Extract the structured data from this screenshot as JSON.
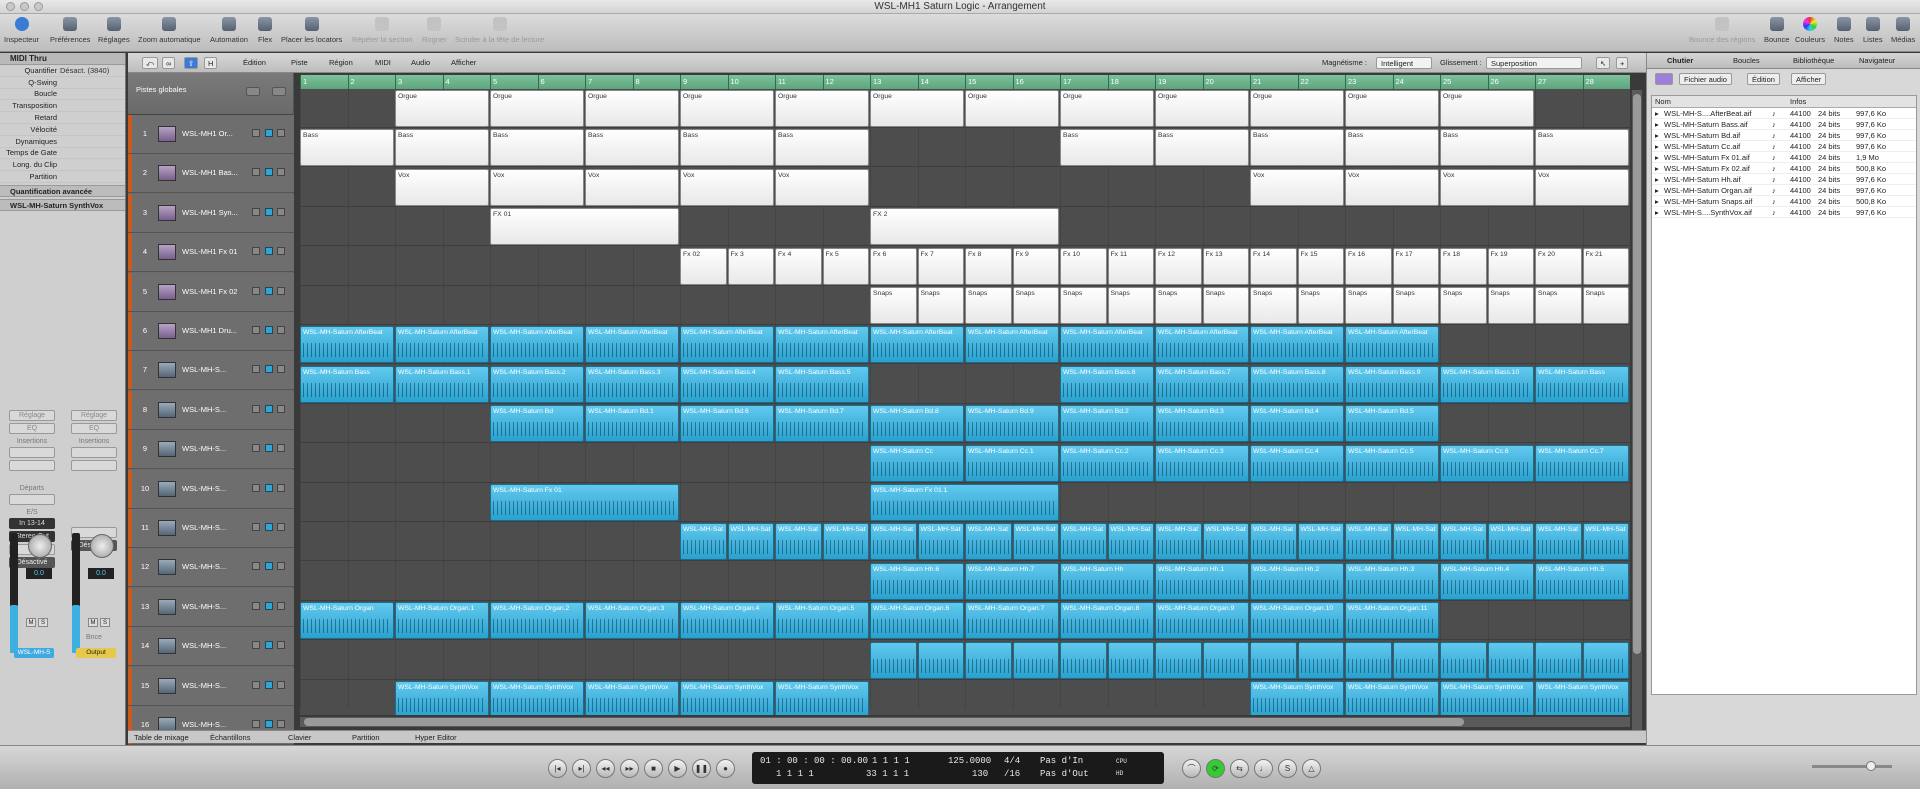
{
  "window": {
    "title": "WSL-MH1 Saturn Logic - Arrangement"
  },
  "toolbar": {
    "left": [
      "Inspecteur",
      "Préférences",
      "Réglages",
      "Zoom automatique",
      "Automation",
      "Flex",
      "Placer les locators",
      "Répéter la section",
      "Rogner",
      "Scinder à la tête de lecture"
    ],
    "right": [
      "Bounce des régions",
      "Bounce",
      "Couleurs",
      "Notes",
      "Listes",
      "Médias"
    ]
  },
  "inspector": {
    "header": "MIDI Thru",
    "params": [
      {
        "label": "Quantifier",
        "value": "Désact. (3840)"
      },
      {
        "label": "Q-Swing",
        "value": ""
      },
      {
        "label": "Boucle",
        "value": ""
      },
      {
        "label": "Transposition",
        "value": ""
      },
      {
        "label": "Retard",
        "value": ""
      },
      {
        "label": "Vélocité",
        "value": ""
      },
      {
        "label": "Dynamiques",
        "value": ""
      },
      {
        "label": "Temps de Gate",
        "value": ""
      },
      {
        "label": "Long. du Clip",
        "value": ""
      },
      {
        "label": "Partition",
        "value": ""
      }
    ],
    "advanced": "Quantification avancée",
    "track_section": "WSL-MH-Saturn SynthVox",
    "strip_left": {
      "setting": "Réglage",
      "eq": "EQ",
      "inserts": "Insertions",
      "sends": "Départs",
      "io": "E/S",
      "input": "In 13-14",
      "output": "Stereo Out",
      "state": "Désactivé",
      "volume": "0.0",
      "name": "WSL-MH-S"
    },
    "strip_right": {
      "setting": "Réglage",
      "eq": "EQ",
      "inserts": "Insertions",
      "state": "Désactivé",
      "volume": "0.0",
      "bounce": "Bnce",
      "name": "Output"
    }
  },
  "menubar": {
    "edit": "Édition",
    "track": "Piste",
    "region": "Région",
    "midi": "MIDI",
    "audio": "Audio",
    "view": "Afficher",
    "magnet_label": "Magnétisme :",
    "magnet_value": "Intelligent",
    "slip_label": "Glissement :",
    "slip_value": "Superposition"
  },
  "global_tracks": "Pistes globales",
  "ruler": [
    "1",
    "2",
    "3",
    "4",
    "5",
    "6",
    "7",
    "8",
    "9",
    "10",
    "11",
    "12",
    "13",
    "14",
    "15",
    "16",
    "17",
    "18",
    "19",
    "20",
    "21",
    "22",
    "23",
    "24",
    "25",
    "26",
    "27",
    "28"
  ],
  "tracks": [
    {
      "num": "1",
      "name": "WSL-MH1 Or...",
      "type": "midi"
    },
    {
      "num": "2",
      "name": "WSL-MH1 Bas...",
      "type": "midi"
    },
    {
      "num": "3",
      "name": "WSL-MH1 Syn...",
      "type": "midi"
    },
    {
      "num": "4",
      "name": "WSL-MH1 Fx 01",
      "type": "midi"
    },
    {
      "num": "5",
      "name": "WSL-MH1 Fx 02",
      "type": "midi"
    },
    {
      "num": "6",
      "name": "WSL-MH1 Dru...",
      "type": "midi"
    },
    {
      "num": "7",
      "name": "WSL-MH-S...",
      "type": "audio"
    },
    {
      "num": "8",
      "name": "WSL-MH-S...",
      "type": "audio"
    },
    {
      "num": "9",
      "name": "WSL-MH-S...",
      "type": "audio"
    },
    {
      "num": "10",
      "name": "WSL-MH-S...",
      "type": "audio"
    },
    {
      "num": "11",
      "name": "WSL-MH-S...",
      "type": "audio"
    },
    {
      "num": "12",
      "name": "WSL-MH-S...",
      "type": "audio"
    },
    {
      "num": "13",
      "name": "WSL-MH-S...",
      "type": "audio"
    },
    {
      "num": "14",
      "name": "WSL-MH-S...",
      "type": "audio"
    },
    {
      "num": "15",
      "name": "WSL-MH-S...",
      "type": "audio"
    },
    {
      "num": "16",
      "name": "WSL-MH-S...",
      "type": "audio"
    }
  ],
  "lanes": [
    {
      "kind": "midi",
      "regions": [
        [
          1,
          "Orgue"
        ],
        [
          2,
          "Orgue"
        ],
        [
          3,
          "Orgue"
        ],
        [
          4,
          "Orgue"
        ],
        [
          5,
          "Orgue"
        ],
        [
          6,
          "Orgue"
        ],
        [
          7,
          "Orgue"
        ],
        [
          8,
          "Orgue"
        ],
        [
          9,
          "Orgue"
        ],
        [
          10,
          "Orgue"
        ],
        [
          11,
          "Orgue"
        ],
        [
          12,
          "Orgue"
        ]
      ]
    },
    {
      "kind": "midi",
      "regions": [
        [
          0,
          "Bass"
        ],
        [
          1,
          "Bass"
        ],
        [
          2,
          "Bass"
        ],
        [
          3,
          "Bass"
        ],
        [
          4,
          "Bass"
        ],
        [
          5,
          "Bass"
        ],
        [
          8,
          "Bass"
        ],
        [
          9,
          "Bass"
        ],
        [
          10,
          "Bass"
        ],
        [
          11,
          "Bass"
        ],
        [
          12,
          "Bass"
        ],
        [
          13,
          "Bass"
        ]
      ]
    },
    {
      "kind": "midi",
      "regions": [
        [
          1,
          "Vox"
        ],
        [
          2,
          "Vox"
        ],
        [
          3,
          "Vox"
        ],
        [
          4,
          "Vox"
        ],
        [
          5,
          "Vox"
        ],
        [
          10,
          "Vox"
        ],
        [
          11,
          "Vox"
        ],
        [
          12,
          "Vox"
        ],
        [
          13,
          "Vox"
        ]
      ]
    },
    {
      "kind": "midi",
      "wide": true,
      "regions": [
        [
          2,
          "FX 01"
        ],
        [
          6,
          "FX 2"
        ]
      ]
    },
    {
      "kind": "midi",
      "half": true,
      "regions": [
        [
          8,
          "Fx 02"
        ],
        [
          9,
          "Fx 3"
        ],
        [
          10,
          "Fx 4"
        ],
        [
          11,
          "Fx 5"
        ],
        [
          12,
          "Fx 6"
        ],
        [
          13,
          "Fx 7"
        ],
        [
          14,
          "Fx 8"
        ],
        [
          15,
          "Fx 9"
        ],
        [
          16,
          "Fx 10"
        ],
        [
          17,
          "Fx 11"
        ],
        [
          18,
          "Fx 12"
        ],
        [
          19,
          "Fx 13"
        ],
        [
          20,
          "Fx 14"
        ],
        [
          21,
          "Fx 15"
        ],
        [
          22,
          "Fx 16"
        ],
        [
          23,
          "Fx 17"
        ],
        [
          24,
          "Fx 18"
        ],
        [
          25,
          "Fx 19"
        ],
        [
          26,
          "Fx 20"
        ],
        [
          27,
          "Fx 21"
        ]
      ]
    },
    {
      "kind": "midi",
      "half": true,
      "regions": [
        [
          12,
          "Snaps"
        ],
        [
          13,
          "Snaps"
        ],
        [
          14,
          "Snaps"
        ],
        [
          15,
          "Snaps"
        ],
        [
          16,
          "Snaps"
        ],
        [
          17,
          "Snaps"
        ],
        [
          18,
          "Snaps"
        ],
        [
          19,
          "Snaps"
        ],
        [
          20,
          "Snaps"
        ],
        [
          21,
          "Snaps"
        ],
        [
          22,
          "Snaps"
        ],
        [
          23,
          "Snaps"
        ],
        [
          24,
          "Snaps"
        ],
        [
          25,
          "Snaps"
        ],
        [
          26,
          "Snaps"
        ],
        [
          27,
          "Snaps"
        ]
      ]
    },
    {
      "kind": "aud",
      "regions": [
        [
          0,
          "WSL-MH-Saturn AfterBeat"
        ],
        [
          1,
          "WSL-MH-Saturn AfterBeat"
        ],
        [
          2,
          "WSL-MH-Saturn AfterBeat"
        ],
        [
          3,
          "WSL-MH-Saturn AfterBeat"
        ],
        [
          4,
          "WSL-MH-Saturn AfterBeat"
        ],
        [
          5,
          "WSL-MH-Saturn AfterBeat"
        ],
        [
          6,
          "WSL-MH-Saturn AfterBeat"
        ],
        [
          7,
          "WSL-MH-Saturn AfterBeat"
        ],
        [
          8,
          "WSL-MH-Saturn AfterBeat"
        ],
        [
          9,
          "WSL-MH-Saturn AfterBeat"
        ],
        [
          10,
          "WSL-MH-Saturn AfterBeat"
        ],
        [
          11,
          "WSL-MH-Saturn AfterBeat"
        ]
      ]
    },
    {
      "kind": "aud",
      "regions": [
        [
          0,
          "WSL-MH-Saturn Bass"
        ],
        [
          1,
          "WSL-MH-Saturn Bass.1"
        ],
        [
          2,
          "WSL-MH-Saturn Bass.2"
        ],
        [
          3,
          "WSL-MH-Saturn Bass.3"
        ],
        [
          4,
          "WSL-MH-Saturn Bass.4"
        ],
        [
          5,
          "WSL-MH-Saturn Bass.5"
        ],
        [
          8,
          "WSL-MH-Saturn Bass.6"
        ],
        [
          9,
          "WSL-MH-Saturn Bass.7"
        ],
        [
          10,
          "WSL-MH-Saturn Bass.8"
        ],
        [
          11,
          "WSL-MH-Saturn Bass.9"
        ],
        [
          12,
          "WSL-MH-Saturn Bass.10"
        ],
        [
          13,
          "WSL-MH-Saturn Bass"
        ]
      ]
    },
    {
      "kind": "aud",
      "regions": [
        [
          2,
          "WSL-MH-Saturn Bd"
        ],
        [
          3,
          "WSL-MH-Saturn Bd.1"
        ],
        [
          4,
          "WSL-MH-Saturn Bd.6"
        ],
        [
          5,
          "WSL-MH-Saturn Bd.7"
        ],
        [
          6,
          "WSL-MH-Saturn Bd.8"
        ],
        [
          7,
          "WSL-MH-Saturn Bd.9"
        ],
        [
          8,
          "WSL-MH-Saturn Bd.2"
        ],
        [
          9,
          "WSL-MH-Saturn Bd.3"
        ],
        [
          10,
          "WSL-MH-Saturn Bd.4"
        ],
        [
          11,
          "WSL-MH-Saturn Bd.5"
        ]
      ]
    },
    {
      "kind": "aud",
      "regions": [
        [
          6,
          "WSL-MH-Saturn Cc"
        ],
        [
          7,
          "WSL-MH-Saturn Cc.1"
        ],
        [
          8,
          "WSL-MH-Saturn Cc.2"
        ],
        [
          9,
          "WSL-MH-Saturn Cc.3"
        ],
        [
          10,
          "WSL-MH-Saturn Cc.4"
        ],
        [
          11,
          "WSL-MH-Saturn Cc.5"
        ],
        [
          12,
          "WSL-MH-Saturn Cc.6"
        ],
        [
          13,
          "WSL-MH-Saturn Cc.7"
        ]
      ]
    },
    {
      "kind": "aud",
      "wide": true,
      "regions": [
        [
          2,
          "WSL-MH-Saturn Fx 01"
        ],
        [
          6,
          "WSL-MH-Saturn Fx 01.1"
        ]
      ]
    },
    {
      "kind": "aud",
      "half": true,
      "regions": [
        [
          8,
          "WSL-MH-Sat"
        ],
        [
          9,
          "WSL-MH-Sat"
        ],
        [
          10,
          "WSL-MH-Sat"
        ],
        [
          11,
          "WSL-MH-Sat"
        ],
        [
          12,
          "WSL-MH-Sat"
        ],
        [
          13,
          "WSL-MH-Sat"
        ],
        [
          14,
          "WSL-MH-Sat"
        ],
        [
          15,
          "WSL-MH-Sat"
        ],
        [
          16,
          "WSL-MH-Sat"
        ],
        [
          17,
          "WSL-MH-Sat"
        ],
        [
          18,
          "WSL-MH-Sat"
        ],
        [
          19,
          "WSL-MH-Sat"
        ],
        [
          20,
          "WSL-MH-Sat"
        ],
        [
          21,
          "WSL-MH-Sat"
        ],
        [
          22,
          "WSL-MH-Sat"
        ],
        [
          23,
          "WSL-MH-Sat"
        ],
        [
          24,
          "WSL-MH-Sat"
        ],
        [
          25,
          "WSL-MH-Sat"
        ],
        [
          26,
          "WSL-MH-Sat"
        ],
        [
          27,
          "WSL-MH-Sat"
        ]
      ]
    },
    {
      "kind": "aud",
      "regions": [
        [
          6,
          "WSL-MH-Saturn Hh.6"
        ],
        [
          7,
          "WSL-MH-Saturn Hh.7"
        ],
        [
          8,
          "WSL-MH-Saturn Hh"
        ],
        [
          9,
          "WSL-MH-Saturn Hh.1"
        ],
        [
          10,
          "WSL-MH-Saturn Hh.2"
        ],
        [
          11,
          "WSL-MH-Saturn Hh.3"
        ],
        [
          12,
          "WSL-MH-Saturn Hh.4"
        ],
        [
          13,
          "WSL-MH-Saturn Hh.5"
        ]
      ]
    },
    {
      "kind": "aud",
      "regions": [
        [
          0,
          "WSL-MH-Saturn Organ"
        ],
        [
          1,
          "WSL-MH-Saturn Organ.1"
        ],
        [
          2,
          "WSL-MH-Saturn Organ.2"
        ],
        [
          3,
          "WSL-MH-Saturn Organ.3"
        ],
        [
          4,
          "WSL-MH-Saturn Organ.4"
        ],
        [
          5,
          "WSL-MH-Saturn Organ.5"
        ],
        [
          6,
          "WSL-MH-Saturn Organ.6"
        ],
        [
          7,
          "WSL-MH-Saturn Organ.7"
        ],
        [
          8,
          "WSL-MH-Saturn Organ.8"
        ],
        [
          9,
          "WSL-MH-Saturn Organ.9"
        ],
        [
          10,
          "WSL-MH-Saturn Organ.10"
        ],
        [
          11,
          "WSL-MH-Saturn Organ.11"
        ]
      ]
    },
    {
      "kind": "aud",
      "half": true,
      "regions": [
        [
          12,
          ""
        ],
        [
          13,
          ""
        ],
        [
          14,
          ""
        ],
        [
          15,
          ""
        ],
        [
          16,
          ""
        ],
        [
          17,
          ""
        ],
        [
          18,
          ""
        ],
        [
          19,
          ""
        ],
        [
          20,
          ""
        ],
        [
          21,
          ""
        ],
        [
          22,
          ""
        ],
        [
          23,
          ""
        ],
        [
          24,
          ""
        ],
        [
          25,
          ""
        ],
        [
          26,
          ""
        ],
        [
          27,
          ""
        ]
      ]
    },
    {
      "kind": "aud",
      "regions": [
        [
          1,
          "WSL-MH-Saturn SynthVox"
        ],
        [
          2,
          "WSL-MH-Saturn SynthVox"
        ],
        [
          3,
          "WSL-MH-Saturn SynthVox"
        ],
        [
          4,
          "WSL-MH-Saturn SynthVox"
        ],
        [
          5,
          "WSL-MH-Saturn SynthVox"
        ],
        [
          10,
          "WSL-MH-Saturn SynthVox"
        ],
        [
          11,
          "WSL-MH-Saturn SynthVox"
        ],
        [
          12,
          "WSL-MH-Saturn SynthVox"
        ],
        [
          13,
          "WSL-MH-Saturn SynthVox"
        ]
      ]
    }
  ],
  "bottom_tabs": [
    "Table de mixage",
    "Échantillons",
    "Clavier",
    "Partition",
    "Hyper Editor"
  ],
  "transport": {
    "smpte": "01 : 00 : 00 : 00.00",
    "pos_top": "1   1   1     1",
    "pos_bottom": "1   1   1     1",
    "end_top": "1   1   1     1",
    "end_bottom": "33   1   1     1",
    "tempo": "125.0000",
    "tempo_bottom": "130",
    "sig": "4/4",
    "div": "/16",
    "in": "Pas d'In",
    "out": "Pas d'Out",
    "cpu": "CPU",
    "hd": "HD"
  },
  "right_panel": {
    "tabs": [
      "Chutier",
      "Boucles",
      "Bibliothèque",
      "Navigateur"
    ],
    "buttons": [
      "Fichier audio",
      "Édition",
      "Afficher"
    ],
    "col_name": "Nom",
    "col_info": "Infos",
    "files": [
      {
        "name": "WSL-MH-S....AfterBeat.aif",
        "rate": "44100",
        "bits": "24 bits",
        "size": "997,6 Ko"
      },
      {
        "name": "WSL-MH-Saturn Bass.aif",
        "rate": "44100",
        "bits": "24 bits",
        "size": "997,6 Ko"
      },
      {
        "name": "WSL-MH-Saturn Bd.aif",
        "rate": "44100",
        "bits": "24 bits",
        "size": "997,6 Ko"
      },
      {
        "name": "WSL-MH-Saturn Cc.aif",
        "rate": "44100",
        "bits": "24 bits",
        "size": "997,6 Ko"
      },
      {
        "name": "WSL-MH-Saturn Fx 01.aif",
        "rate": "44100",
        "bits": "24 bits",
        "size": "1,9 Mo"
      },
      {
        "name": "WSL-MH-Saturn Fx 02.aif",
        "rate": "44100",
        "bits": "24 bits",
        "size": "500,8 Ko"
      },
      {
        "name": "WSL-MH-Saturn Hh.aif",
        "rate": "44100",
        "bits": "24 bits",
        "size": "997,6 Ko"
      },
      {
        "name": "WSL-MH-Saturn Organ.aif",
        "rate": "44100",
        "bits": "24 bits",
        "size": "997,6 Ko"
      },
      {
        "name": "WSL-MH-Saturn Snaps.aif",
        "rate": "44100",
        "bits": "24 bits",
        "size": "500,8 Ko"
      },
      {
        "name": "WSL-MH-S....SynthVox.aif",
        "rate": "44100",
        "bits": "24 bits",
        "size": "997,6 Ko"
      }
    ]
  }
}
